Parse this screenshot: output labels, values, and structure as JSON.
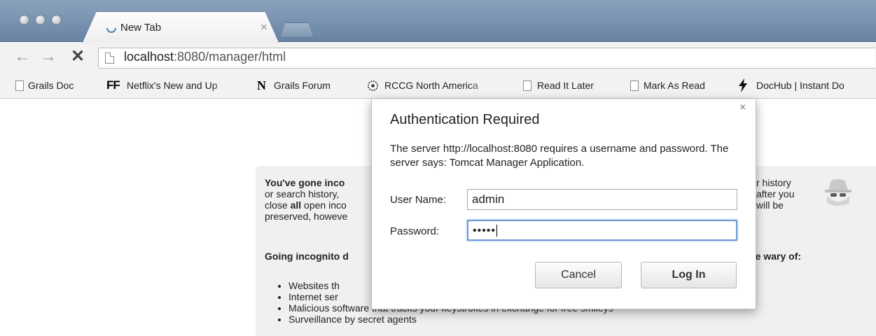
{
  "tab": {
    "title": "New Tab",
    "close_glyph": "×"
  },
  "toolbar": {
    "back_glyph": "←",
    "forward_glyph": "→",
    "stop_glyph": "✕",
    "url_host": "localhost",
    "url_path": ":8080/manager/html"
  },
  "bookmarks": [
    {
      "label": "Grails Doc",
      "icon": "page-icon"
    },
    {
      "label": "Netflix's New and Up",
      "icon_text": "FF"
    },
    {
      "label": "Grails Forum",
      "icon_text": "N"
    },
    {
      "label": "RCCG North America",
      "icon": "gear-badge-icon"
    },
    {
      "label": "Read It Later",
      "icon": "page-icon"
    },
    {
      "label": "Mark As Read",
      "icon": "page-icon"
    },
    {
      "label": "DocHub | Instant Do",
      "icon": "lightning-icon"
    }
  ],
  "incognito": {
    "line1_bold": "You've gone inco",
    "line2": "or search history, ",
    "line3_pre": "close ",
    "line3_bold": "all",
    "line3_post": " open inco",
    "line4": "preserved, howeve",
    "right1": "r history",
    "right2": "after you",
    "right3": "will be",
    "heading_left": "Going incognito d",
    "heading_right": "e. Be wary of:",
    "list": [
      "Websites th",
      "Internet ser",
      "Malicious software that tracks your keystrokes in exchange for free smileys",
      "Surveillance by secret agents"
    ]
  },
  "dialog": {
    "title": "Authentication Required",
    "close_glyph": "×",
    "message": "The server http://localhost:8080 requires a username and password. The server says: Tomcat Manager Application.",
    "username_label": "User Name:",
    "username_value": "admin",
    "password_label": "Password:",
    "password_value": "•••••",
    "cancel_label": "Cancel",
    "login_label": "Log In"
  },
  "colors": {
    "titlebar": "#7a93b1",
    "focus_ring": "#6b9ad8"
  }
}
